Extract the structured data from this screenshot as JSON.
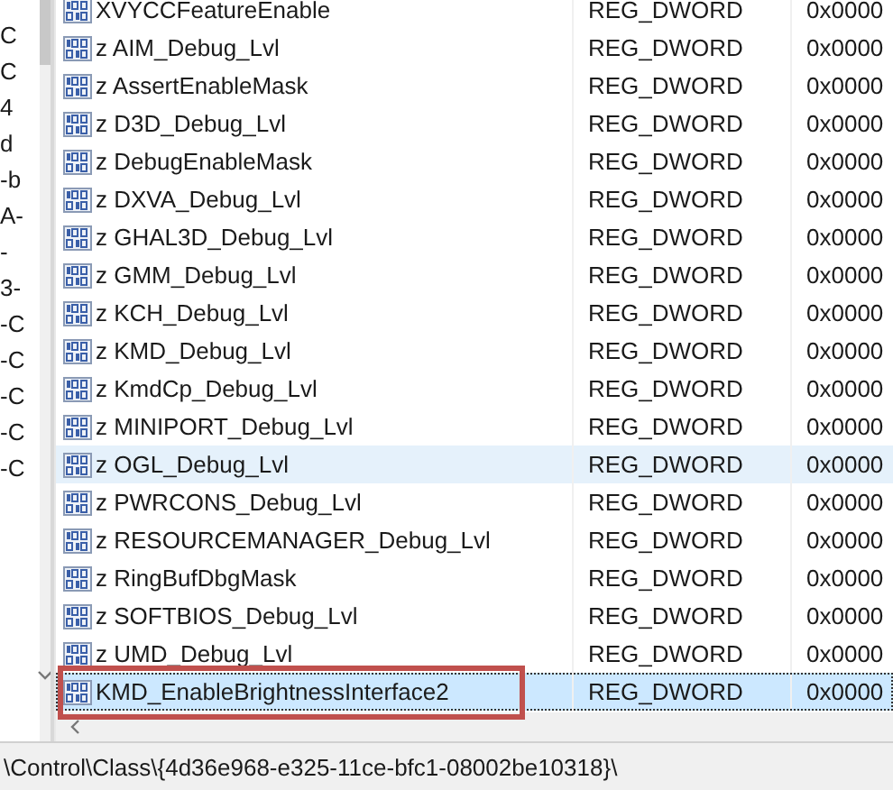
{
  "tree_pane": {
    "fragments": [
      "C",
      "C",
      "4",
      "d",
      "-b",
      "A-",
      "-",
      "3-",
      "-C",
      "-C",
      "-C",
      "-C",
      "-C"
    ]
  },
  "values": {
    "rows": [
      {
        "name": "XVYCCFeatureEnable",
        "type": "REG_DWORD",
        "data": "0x0000",
        "selected": false,
        "hovered": false,
        "annotated": false
      },
      {
        "name": "z AIM_Debug_Lvl",
        "type": "REG_DWORD",
        "data": "0x0000",
        "selected": false,
        "hovered": false,
        "annotated": false
      },
      {
        "name": "z AssertEnableMask",
        "type": "REG_DWORD",
        "data": "0x0000",
        "selected": false,
        "hovered": false,
        "annotated": false
      },
      {
        "name": "z D3D_Debug_Lvl",
        "type": "REG_DWORD",
        "data": "0x0000",
        "selected": false,
        "hovered": false,
        "annotated": false
      },
      {
        "name": "z DebugEnableMask",
        "type": "REG_DWORD",
        "data": "0x0000",
        "selected": false,
        "hovered": false,
        "annotated": false
      },
      {
        "name": "z DXVA_Debug_Lvl",
        "type": "REG_DWORD",
        "data": "0x0000",
        "selected": false,
        "hovered": false,
        "annotated": false
      },
      {
        "name": "z GHAL3D_Debug_Lvl",
        "type": "REG_DWORD",
        "data": "0x0000",
        "selected": false,
        "hovered": false,
        "annotated": false
      },
      {
        "name": "z GMM_Debug_Lvl",
        "type": "REG_DWORD",
        "data": "0x0000",
        "selected": false,
        "hovered": false,
        "annotated": false
      },
      {
        "name": "z KCH_Debug_Lvl",
        "type": "REG_DWORD",
        "data": "0x0000",
        "selected": false,
        "hovered": false,
        "annotated": false
      },
      {
        "name": "z KMD_Debug_Lvl",
        "type": "REG_DWORD",
        "data": "0x0000",
        "selected": false,
        "hovered": false,
        "annotated": false
      },
      {
        "name": "z KmdCp_Debug_Lvl",
        "type": "REG_DWORD",
        "data": "0x0000",
        "selected": false,
        "hovered": false,
        "annotated": false
      },
      {
        "name": "z MINIPORT_Debug_Lvl",
        "type": "REG_DWORD",
        "data": "0x0000",
        "selected": false,
        "hovered": false,
        "annotated": false
      },
      {
        "name": "z OGL_Debug_Lvl",
        "type": "REG_DWORD",
        "data": "0x0000",
        "selected": false,
        "hovered": true,
        "annotated": false
      },
      {
        "name": "z PWRCONS_Debug_Lvl",
        "type": "REG_DWORD",
        "data": "0x0000",
        "selected": false,
        "hovered": false,
        "annotated": false
      },
      {
        "name": "z RESOURCEMANAGER_Debug_Lvl",
        "type": "REG_DWORD",
        "data": "0x0000",
        "selected": false,
        "hovered": false,
        "annotated": false
      },
      {
        "name": "z RingBufDbgMask",
        "type": "REG_DWORD",
        "data": "0x0000",
        "selected": false,
        "hovered": false,
        "annotated": false
      },
      {
        "name": "z SOFTBIOS_Debug_Lvl",
        "type": "REG_DWORD",
        "data": "0x0000",
        "selected": false,
        "hovered": false,
        "annotated": false
      },
      {
        "name": "z UMD_Debug_Lvl",
        "type": "REG_DWORD",
        "data": "0x0000",
        "selected": false,
        "hovered": false,
        "annotated": false
      },
      {
        "name": "KMD_EnableBrightnessInterface2",
        "type": "REG_DWORD",
        "data": "0x0000",
        "selected": true,
        "hovered": false,
        "annotated": true
      }
    ]
  },
  "status_bar": {
    "path": "\\Control\\Class\\{4d36e968-e325-11ce-bfc1-08002be10318}\\"
  }
}
